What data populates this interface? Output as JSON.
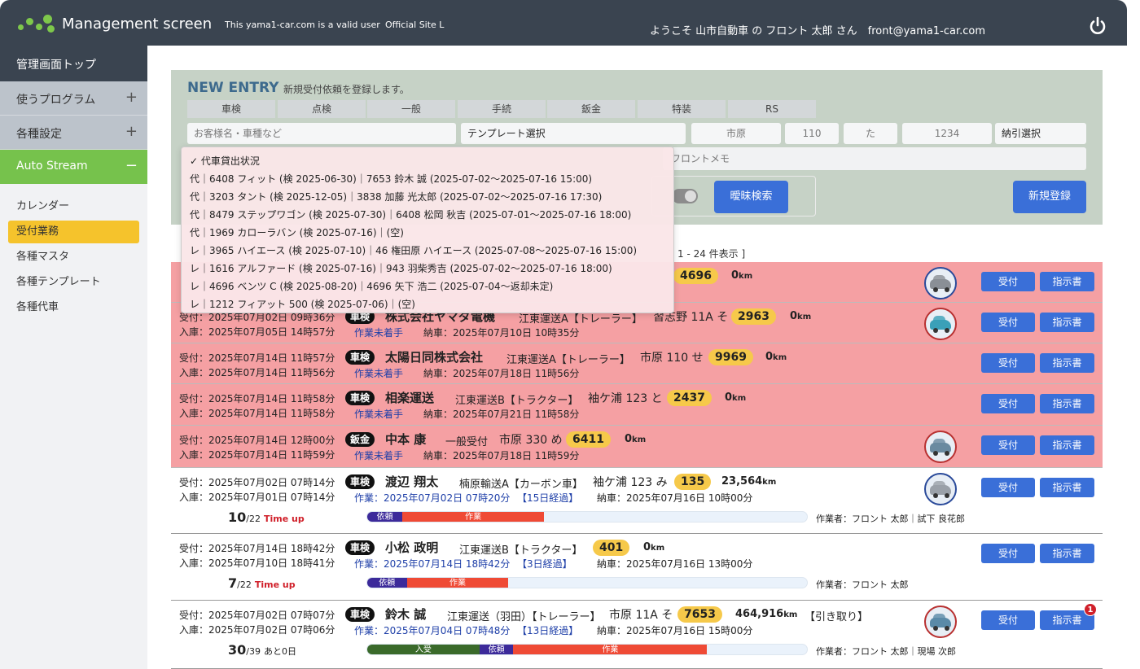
{
  "header": {
    "app_title": "Management screen",
    "valid_user": "This yama1-car.com is a valid user",
    "official_site": "Official Site L",
    "welcome": "ようこそ 山市自動車 の フロント 太郎 さん　front@yama1-car.com"
  },
  "sidebar": {
    "top": "管理画面トップ",
    "sections": [
      {
        "label": "使うプログラム",
        "toggle": "+"
      },
      {
        "label": "各種設定",
        "toggle": "+"
      }
    ],
    "auto": {
      "label": "Auto Stream",
      "toggle": "−"
    },
    "sub": [
      "カレンダー",
      "受付業務",
      "各種マスタ",
      "各種テンプレート",
      "各種代車"
    ]
  },
  "entry": {
    "title": "NEW ENTRY",
    "subtitle": "新規受付依頼を登録します。",
    "categories": [
      "車検",
      "点検",
      "一般",
      "手続",
      "鈑金",
      "特装",
      "RS"
    ],
    "customer_placeholder": "お客様名・車種など",
    "template_select": "テンプレート選択",
    "plate_area": "市原",
    "plate_class": "110",
    "plate_kana": "た",
    "plate_number": "1234",
    "delivery_select": "納引選択",
    "memo_placeholder": "フロントメモ",
    "fuzzy_button": "曖昧検索",
    "register_button": "新規登録"
  },
  "dropdown": {
    "items": [
      "✓ 代車貸出状況",
      "代｜6408 フィット (検 2025-06-30)｜7653 鈴木 誠 (2025-07-02～2025-07-16 15:00)",
      "代｜3203 タント (検 2025-12-05)｜3838 加藤 光太郎 (2025-07-02～2025-07-16 17:30)",
      "代｜8479 ステップワゴン (検 2025-07-30)｜6408 松岡 秋吉 (2025-07-01～2025-07-16 18:00)",
      "代｜1969 カローラバン (検 2025-07-16)｜(空)",
      "レ｜3965 ハイエース (検 2025-07-10)｜46 権田原 ハイエース (2025-07-08～2025-07-16 15:00)",
      "レ｜1616 アルファード (検 2025-07-16)｜943 羽柴秀吉 (2025-07-02～2025-07-16 18:00)",
      "レ｜4696 ベンツ C (検 2025-08-20)｜4696 矢下 浩二 (2025-07-04～返却未定)",
      "レ｜1212 フィアット 500 (検 2025-07-06)｜(空)"
    ]
  },
  "paging": "1 - 24 件表示 ]",
  "buttons": {
    "accept": "受付",
    "instruction": "指示書"
  },
  "rows": [
    {
      "num": "4696",
      "odo": "0",
      "odo_unit": "km",
      "car_color": "#8a8f96"
    },
    {
      "recv": "受付：2025年07月02日 09時36分",
      "in": "入庫：2025年07月05日 14時57分",
      "kind": "車検",
      "customer": "株式会社ヤマダ電機",
      "vehicle": "江東運送A【トレーラー】",
      "plate": "習志野 11A そ",
      "num": "2963",
      "odo": "0",
      "odo_unit": "km",
      "status": "作業未着手",
      "delivery": "納車：2025年07月10日 10時35分",
      "car_color": "#3aa0b8"
    },
    {
      "recv": "受付：2025年07月14日 11時57分",
      "in": "入庫：2025年07月14日 11時56分",
      "kind": "車検",
      "customer": "太陽日同株式会社",
      "vehicle": "江東運送A【トレーラー】",
      "plate": "市原 110 せ",
      "num": "9969",
      "odo": "0",
      "odo_unit": "km",
      "status": "作業未着手",
      "delivery": "納車：2025年07月18日 11時56分"
    },
    {
      "recv": "受付：2025年07月14日 11時58分",
      "in": "入庫：2025年07月14日 11時58分",
      "kind": "車検",
      "customer": "相楽運送",
      "vehicle": "江東運送B【トラクター】",
      "plate": "袖ケ浦 123 と",
      "num": "2437",
      "odo": "0",
      "odo_unit": "km",
      "status": "作業未着手",
      "delivery": "納車：2025年07月21日 11時58分"
    },
    {
      "recv": "受付：2025年07月14日 12時00分",
      "in": "入庫：2025年07月14日 11時59分",
      "kind": "鈑金",
      "customer": "中本 康",
      "vehicle": "一般受付",
      "plate": "市原 330 め",
      "num": "6411",
      "odo": "0",
      "odo_unit": "km",
      "status": "作業未着手",
      "delivery": "納車：2025年07月18日 11時59分",
      "car_color": "#6a8aa0"
    },
    {
      "recv": "受付：2025年07月02日 07時14分",
      "in": "入庫：2025年07月01日 07時14分",
      "kind": "車検",
      "customer": "渡辺 翔太",
      "vehicle": "楠原輸送A【カーボン車】",
      "plate": "袖ケ浦 123 み",
      "num": "135",
      "odo": "23,564",
      "odo_unit": "km",
      "work": "作業：2025年07月02日 07時20分",
      "elapsed": "【15日経過】",
      "delivery": "納車：2025年07月16日 10時00分",
      "count": "10",
      "total": "/22",
      "count_note": "Time up",
      "segments": [
        {
          "label": "依頼",
          "frac": 0.2,
          "color": "#3c2a9a"
        },
        {
          "label": "作業",
          "frac": 0.8,
          "color": "#ef4a35"
        }
      ],
      "progress": 0.4,
      "worker": "作業者：フロント 太郎｜試下 良花郎",
      "car_color": "#9aa0a8"
    },
    {
      "recv": "受付：2025年07月14日 18時42分",
      "in": "入庫：2025年07月10日 18時41分",
      "kind": "車検",
      "customer": "小松 政明",
      "vehicle": "江東運送B【トラクター】",
      "plate": "",
      "num": "401",
      "odo": "0",
      "odo_unit": "km",
      "work": "作業：2025年07月14日 18時42分",
      "elapsed": "【3日経過】",
      "delivery": "納車：2025年07月16日 13時00分",
      "count": "7",
      "total": "/22",
      "count_note": "Time up",
      "segments": [
        {
          "label": "依頼",
          "frac": 0.28,
          "color": "#3c2a9a"
        },
        {
          "label": "作業",
          "frac": 0.72,
          "color": "#ef4a35"
        }
      ],
      "progress": 0.32,
      "worker": "作業者：フロント 太郎"
    },
    {
      "recv": "受付：2025年07月02日 07時07分",
      "in": "入庫：2025年07月02日 07時06分",
      "kind": "車検",
      "customer": "鈴木 誠",
      "vehicle": "江東運送（羽田）【トレーラー】",
      "plate": "市原 11A そ",
      "num": "7653",
      "odo": "464,916",
      "odo_unit": "km",
      "note": "【引き取り】",
      "work": "作業：2025年07月04日 07時48分",
      "elapsed": "【13日経過】",
      "delivery": "納車：2025年07月16日 15時00分",
      "count": "30",
      "total": "/39",
      "count_note": "あと0日",
      "segments": [
        {
          "label": "入受",
          "frac": 0.33,
          "color": "#3a6a2a"
        },
        {
          "label": "依頼",
          "frac": 0.1,
          "color": "#3c2a9a"
        },
        {
          "label": "作業",
          "frac": 0.57,
          "color": "#ef4a35"
        }
      ],
      "progress": 0.77,
      "worker": "作業者：フロント 太郎｜現場 次郎",
      "badge": "1",
      "car_color": "#5a8aa8"
    }
  ]
}
